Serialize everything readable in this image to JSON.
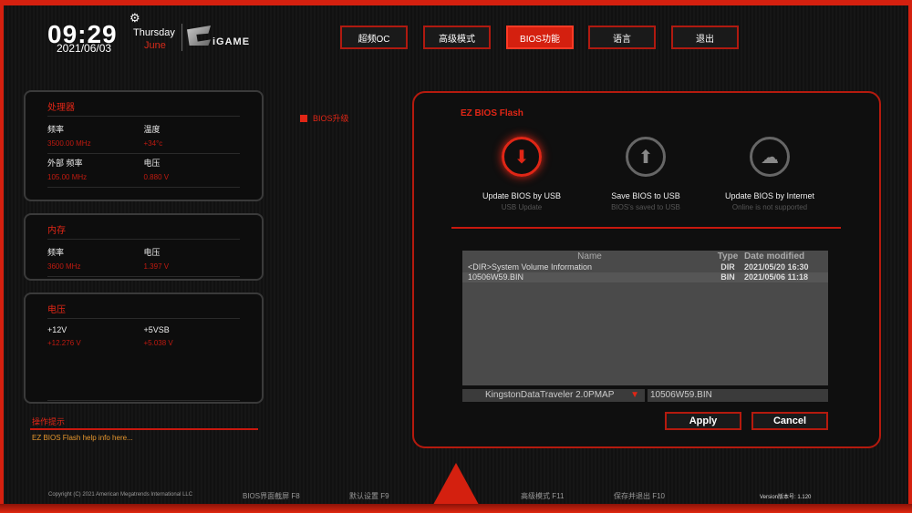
{
  "header": {
    "time": "09:29",
    "date": "2021/06/03",
    "day": "Thursday",
    "month": "June",
    "brand": "iGAME",
    "gear_icon": "gear-icon"
  },
  "nav": [
    {
      "label": "超频OC"
    },
    {
      "label": "高级模式"
    },
    {
      "label": "BIOS功能",
      "active": true
    },
    {
      "label": "语言"
    },
    {
      "label": "退出"
    }
  ],
  "cpu": {
    "title": "处理器",
    "items": [
      {
        "label": "频率",
        "value": "3500.00 MHz"
      },
      {
        "label": "温度",
        "value": "+34°c"
      },
      {
        "label": "外部 频率",
        "value": "105.00 MHz"
      },
      {
        "label": "电压",
        "value": "0.880 V"
      }
    ]
  },
  "memory": {
    "title": "内存",
    "items": [
      {
        "label": "频率",
        "value": "3600 MHz"
      },
      {
        "label": "电压",
        "value": "1.397 V"
      }
    ]
  },
  "voltage": {
    "title": "电压",
    "items": [
      {
        "label": "+12V",
        "value": "+12.276 V"
      },
      {
        "label": "+5VSB",
        "value": "+5.038 V"
      }
    ]
  },
  "hint": {
    "title": "操作提示",
    "text": "EZ BIOS Flash help info here..."
  },
  "section": "BIOS升级",
  "flash": {
    "title": "EZ BIOS Flash",
    "options": [
      {
        "label": "Update BIOS by USB",
        "sub": "USB Update",
        "icon": "usb-download-icon"
      },
      {
        "label": "Save BIOS to USB",
        "sub": "BIOS's saved to USB",
        "icon": "usb-upload-icon"
      },
      {
        "label": "Update BIOS by Internet",
        "sub": "Online is not supported",
        "icon": "cloud-download-icon"
      }
    ],
    "columns": [
      "Name",
      "Type",
      "Date modified"
    ],
    "rows": [
      [
        "<DIR>System Volume Information",
        "DIR",
        "2021/05/20 16:30"
      ],
      [
        "10506W59.BIN",
        "BIN",
        "2021/05/06 11:18"
      ]
    ],
    "drive": "KingstonDataTraveler 2.0PMAP",
    "file": "10506W59.BIN",
    "apply": "Apply",
    "cancel": "Cancel"
  },
  "accent": "#d4200f",
  "footer": {
    "copyright": "Copyright (C) 2021 American Megatrends International LLC",
    "f8": "BIOS界面截屏 F8",
    "f9": "默认设置 F9",
    "f11": "高级模式 F11",
    "f10": "保存并退出 F10",
    "version": "Version版本号: 1.120"
  }
}
